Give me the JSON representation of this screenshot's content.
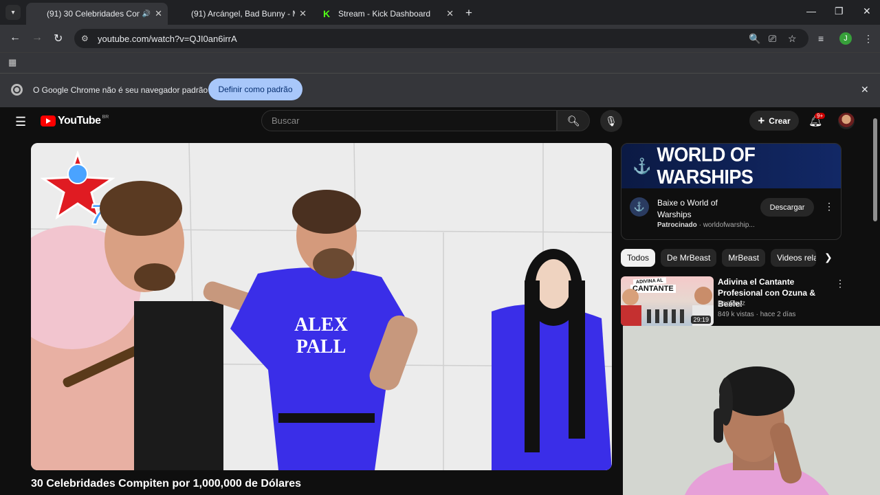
{
  "browser": {
    "tabs": [
      {
        "title": "(91) 30 Celebridades Comp",
        "icon": "youtube-icon",
        "active": true,
        "audio": true
      },
      {
        "title": "(91) Arcángel, Bad Bunny - Me",
        "icon": "youtube-icon",
        "active": false
      },
      {
        "title": "Stream - Kick Dashboard",
        "icon": "kick-icon",
        "active": false
      }
    ],
    "url": "youtube.com/watch?v=QJI0an6irrA",
    "profile_initial": "J",
    "infobar": {
      "message": "O Google Chrome não é seu navegador padrão",
      "button": "Definir como padrão"
    }
  },
  "youtube": {
    "logo_text": "YouTube",
    "country_code": "BR",
    "search_placeholder": "Buscar",
    "create_label": "Crear",
    "notifications_badge": "9+",
    "video": {
      "title": "30 Celebridades Compiten por 1,000,000 de Dólares",
      "jersey_text_line1": "ALEX",
      "jersey_text_line2": "PALL"
    },
    "ad": {
      "banner": "WORLD OF WARSHIPS",
      "title": "Baixe o World of Warships",
      "sponsored": "Patrocinado",
      "domain": "worldofwarship...",
      "button": "Descargar"
    },
    "chips": [
      "Todos",
      "De MrBeast",
      "MrBeast",
      "Videos relac"
    ],
    "recommendations": [
      {
        "title": "Adivina el Cantante Profesional con Ozuna & Beéle!",
        "channel": "BagBoyz",
        "meta": "849 k vistas · hace 2 días",
        "duration": "29:19",
        "thumb_label_small": "ADIVINA AL",
        "thumb_label_big": "CANTANTE"
      }
    ]
  },
  "colors": {
    "youtube_red": "#ff0000",
    "chrome_dark": "#202124",
    "chrome_toolbar": "#35363a",
    "default_button": "#a8c7fa",
    "jersey_blue": "#3a2ee8"
  }
}
